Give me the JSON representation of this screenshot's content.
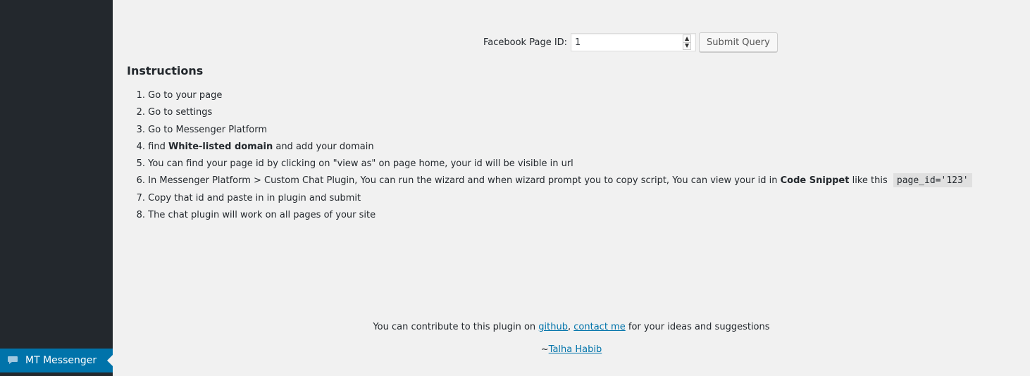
{
  "sidebar": {
    "menu_item": {
      "label": "MT Messenger",
      "icon": "speech-bubble-icon",
      "active_color": "#0073aa"
    },
    "background": "#23282d"
  },
  "form": {
    "label": "Facebook Page ID:",
    "page_id_value": "1",
    "submit_label": "Submit Query"
  },
  "instructions": {
    "title": "Instructions",
    "steps": [
      {
        "num": "1.",
        "text": "Go to your page"
      },
      {
        "num": "2.",
        "text": "Go to settings"
      },
      {
        "num": "3.",
        "text": "Go to Messenger Platform"
      },
      {
        "num": "4.",
        "pre": "find ",
        "bold": "White-listed domain",
        "post": " and add your domain"
      },
      {
        "num": "5.",
        "text": "You can find your page id by clicking on \"view as\" on page home, your id will be visible in url"
      },
      {
        "num": "6.",
        "pre": "In Messenger Platform > Custom Chat Plugin, You can run the wizard and when wizard prompt you to copy script, You can view your id in ",
        "bold": "Code Snippet",
        "post": " like this ",
        "code": "page_id='123'"
      },
      {
        "num": "7.",
        "text": "Copy that id and paste in in plugin and submit"
      },
      {
        "num": "8.",
        "text": "The chat plugin will work on all pages of your site"
      }
    ]
  },
  "footer": {
    "prefix": "You can contribute to this plugin on ",
    "github_link": "github",
    "comma": ",",
    "contact_link": "contact me",
    "suffix": " for your ideas and suggestions",
    "tilde": "~",
    "author_link": "Talha Habib"
  }
}
